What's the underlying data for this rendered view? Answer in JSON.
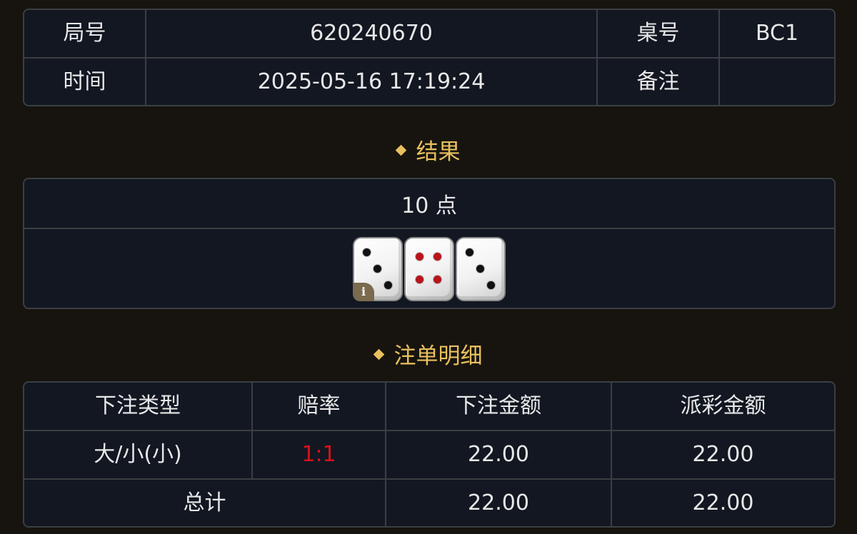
{
  "info": {
    "round_label": "局号",
    "round_value": "620240670",
    "table_label": "桌号",
    "table_value": "BC1",
    "time_label": "时间",
    "time_value": "2025-05-16 17:19:24",
    "note_label": "备注",
    "note_value": ""
  },
  "result": {
    "title": "结果",
    "points_text": "10 点",
    "dice": [
      {
        "value": 3,
        "icon": "die-three-icon"
      },
      {
        "value": 4,
        "icon": "die-four-icon"
      },
      {
        "value": 3,
        "icon": "die-three-icon"
      }
    ],
    "info_badge": "i"
  },
  "bets": {
    "title": "注单明细",
    "headers": [
      "下注类型",
      "赔率",
      "下注金额",
      "派彩金额"
    ],
    "rows": [
      {
        "type": "大/小(小)",
        "odds": "1:1",
        "amount": "22.00",
        "payout": "22.00"
      }
    ],
    "total": {
      "label": "总计",
      "amount": "22.00",
      "payout": "22.00"
    }
  },
  "colors": {
    "background": "#17140f",
    "panel": "#121722",
    "border": "#3b3f42",
    "accent_gold": "#e9c05e",
    "odds_red": "#d4121b"
  }
}
